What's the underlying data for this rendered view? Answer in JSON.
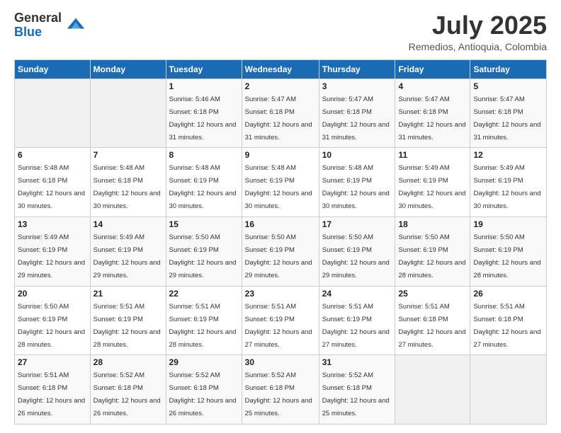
{
  "logo": {
    "general": "General",
    "blue": "Blue"
  },
  "header": {
    "month_year": "July 2025",
    "location": "Remedios, Antioquia, Colombia"
  },
  "weekdays": [
    "Sunday",
    "Monday",
    "Tuesday",
    "Wednesday",
    "Thursday",
    "Friday",
    "Saturday"
  ],
  "weeks": [
    [
      {
        "day": "",
        "empty": true
      },
      {
        "day": "",
        "empty": true
      },
      {
        "day": "1",
        "sunrise": "5:46 AM",
        "sunset": "6:18 PM",
        "daylight": "12 hours and 31 minutes."
      },
      {
        "day": "2",
        "sunrise": "5:47 AM",
        "sunset": "6:18 PM",
        "daylight": "12 hours and 31 minutes."
      },
      {
        "day": "3",
        "sunrise": "5:47 AM",
        "sunset": "6:18 PM",
        "daylight": "12 hours and 31 minutes."
      },
      {
        "day": "4",
        "sunrise": "5:47 AM",
        "sunset": "6:18 PM",
        "daylight": "12 hours and 31 minutes."
      },
      {
        "day": "5",
        "sunrise": "5:47 AM",
        "sunset": "6:18 PM",
        "daylight": "12 hours and 31 minutes."
      }
    ],
    [
      {
        "day": "6",
        "sunrise": "5:48 AM",
        "sunset": "6:18 PM",
        "daylight": "12 hours and 30 minutes."
      },
      {
        "day": "7",
        "sunrise": "5:48 AM",
        "sunset": "6:18 PM",
        "daylight": "12 hours and 30 minutes."
      },
      {
        "day": "8",
        "sunrise": "5:48 AM",
        "sunset": "6:19 PM",
        "daylight": "12 hours and 30 minutes."
      },
      {
        "day": "9",
        "sunrise": "5:48 AM",
        "sunset": "6:19 PM",
        "daylight": "12 hours and 30 minutes."
      },
      {
        "day": "10",
        "sunrise": "5:48 AM",
        "sunset": "6:19 PM",
        "daylight": "12 hours and 30 minutes."
      },
      {
        "day": "11",
        "sunrise": "5:49 AM",
        "sunset": "6:19 PM",
        "daylight": "12 hours and 30 minutes."
      },
      {
        "day": "12",
        "sunrise": "5:49 AM",
        "sunset": "6:19 PM",
        "daylight": "12 hours and 30 minutes."
      }
    ],
    [
      {
        "day": "13",
        "sunrise": "5:49 AM",
        "sunset": "6:19 PM",
        "daylight": "12 hours and 29 minutes."
      },
      {
        "day": "14",
        "sunrise": "5:49 AM",
        "sunset": "6:19 PM",
        "daylight": "12 hours and 29 minutes."
      },
      {
        "day": "15",
        "sunrise": "5:50 AM",
        "sunset": "6:19 PM",
        "daylight": "12 hours and 29 minutes."
      },
      {
        "day": "16",
        "sunrise": "5:50 AM",
        "sunset": "6:19 PM",
        "daylight": "12 hours and 29 minutes."
      },
      {
        "day": "17",
        "sunrise": "5:50 AM",
        "sunset": "6:19 PM",
        "daylight": "12 hours and 29 minutes."
      },
      {
        "day": "18",
        "sunrise": "5:50 AM",
        "sunset": "6:19 PM",
        "daylight": "12 hours and 28 minutes."
      },
      {
        "day": "19",
        "sunrise": "5:50 AM",
        "sunset": "6:19 PM",
        "daylight": "12 hours and 28 minutes."
      }
    ],
    [
      {
        "day": "20",
        "sunrise": "5:50 AM",
        "sunset": "6:19 PM",
        "daylight": "12 hours and 28 minutes."
      },
      {
        "day": "21",
        "sunrise": "5:51 AM",
        "sunset": "6:19 PM",
        "daylight": "12 hours and 28 minutes."
      },
      {
        "day": "22",
        "sunrise": "5:51 AM",
        "sunset": "6:19 PM",
        "daylight": "12 hours and 28 minutes."
      },
      {
        "day": "23",
        "sunrise": "5:51 AM",
        "sunset": "6:19 PM",
        "daylight": "12 hours and 27 minutes."
      },
      {
        "day": "24",
        "sunrise": "5:51 AM",
        "sunset": "6:19 PM",
        "daylight": "12 hours and 27 minutes."
      },
      {
        "day": "25",
        "sunrise": "5:51 AM",
        "sunset": "6:18 PM",
        "daylight": "12 hours and 27 minutes."
      },
      {
        "day": "26",
        "sunrise": "5:51 AM",
        "sunset": "6:18 PM",
        "daylight": "12 hours and 27 minutes."
      }
    ],
    [
      {
        "day": "27",
        "sunrise": "5:51 AM",
        "sunset": "6:18 PM",
        "daylight": "12 hours and 26 minutes."
      },
      {
        "day": "28",
        "sunrise": "5:52 AM",
        "sunset": "6:18 PM",
        "daylight": "12 hours and 26 minutes."
      },
      {
        "day": "29",
        "sunrise": "5:52 AM",
        "sunset": "6:18 PM",
        "daylight": "12 hours and 26 minutes."
      },
      {
        "day": "30",
        "sunrise": "5:52 AM",
        "sunset": "6:18 PM",
        "daylight": "12 hours and 25 minutes."
      },
      {
        "day": "31",
        "sunrise": "5:52 AM",
        "sunset": "6:18 PM",
        "daylight": "12 hours and 25 minutes."
      },
      {
        "day": "",
        "empty": true
      },
      {
        "day": "",
        "empty": true
      }
    ]
  ]
}
